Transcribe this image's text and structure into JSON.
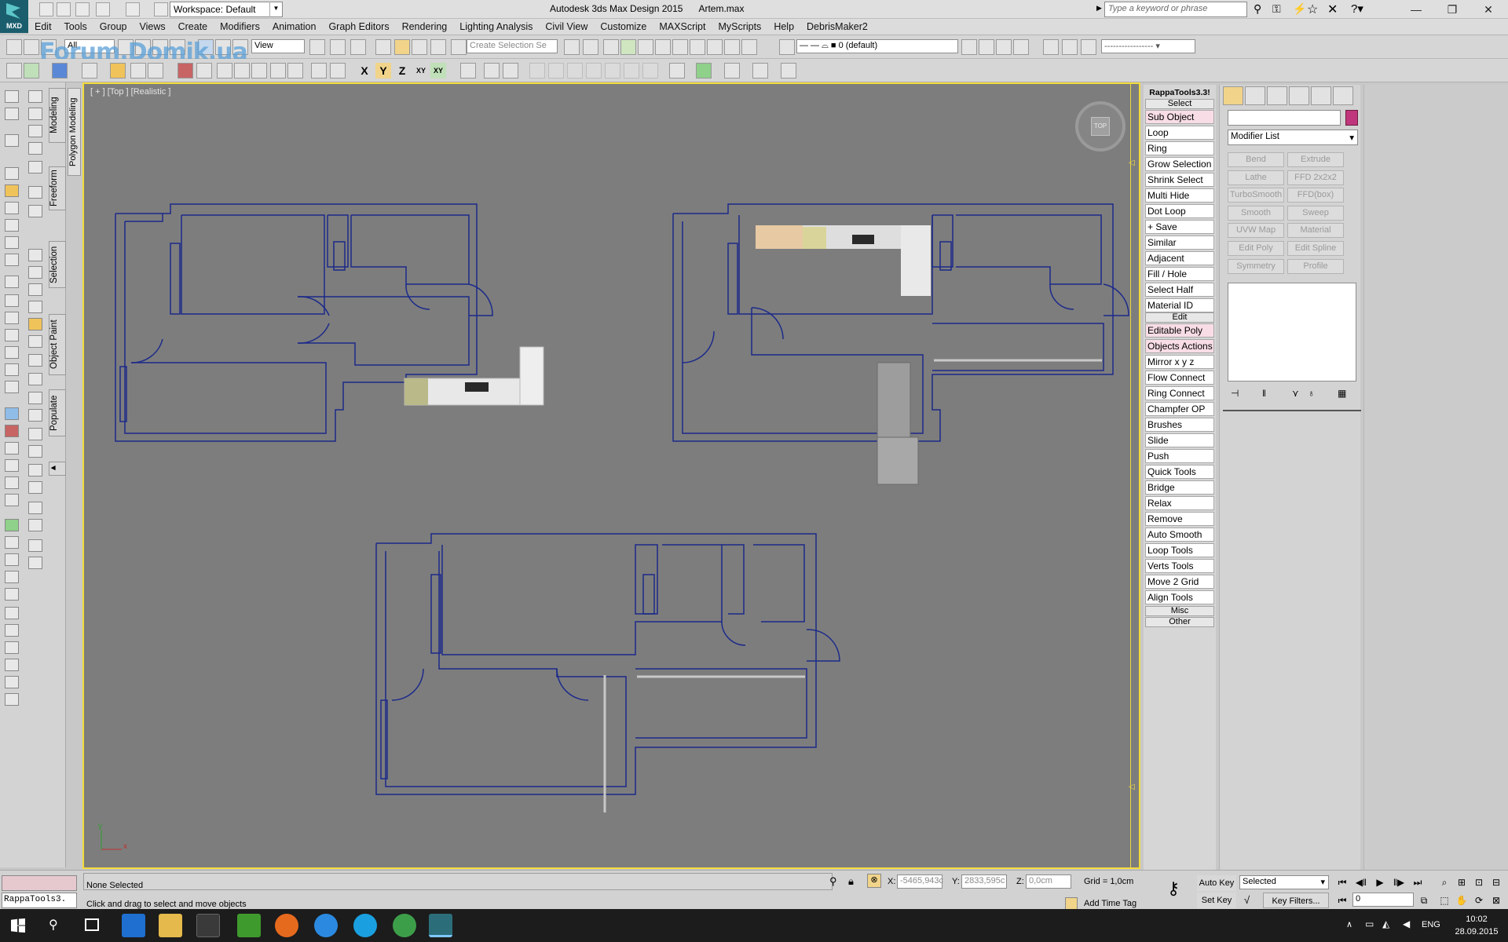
{
  "window": {
    "title": "Autodesk 3ds Max Design 2015",
    "file": "Artem.max",
    "logo_text": "MXD",
    "workspace": "Workspace: Default",
    "search_placeholder": "Type a keyword or phrase"
  },
  "menu": [
    "Edit",
    "Tools",
    "Group",
    "Views",
    "Create",
    "Modifiers",
    "Animation",
    "Graph Editors",
    "Rendering",
    "Lighting Analysis",
    "Civil View",
    "Customize",
    "MAXScript",
    "MyScripts",
    "Help",
    "DebrisMaker2"
  ],
  "toolbar": {
    "selection_filter": "All",
    "ref_coord": "View",
    "named_selection": "Create Selection Se",
    "layer": "0 (default)",
    "axis_x": "X",
    "axis_y": "Y",
    "axis_z": "Z",
    "axis_xy": "XY",
    "axis_xyz": "XY"
  },
  "watermark": "Forum.Domik.ua",
  "ribbon_tabs": [
    "Modeling",
    "Freeform",
    "Selection",
    "Object Paint",
    "Populate"
  ],
  "ribbon_sub": "Polygon Modeling",
  "viewport": {
    "label": "[ + ] [Top ] [Realistic ]",
    "navcube_face": "TOP",
    "axis_x": "x",
    "axis_y": "y"
  },
  "rappa": {
    "title": "RappaTools3.3!",
    "sections": [
      {
        "label": "Select",
        "items": [
          {
            "label": "Sub Object",
            "pink": true
          },
          {
            "label": "Loop",
            "pink": false
          },
          {
            "label": "Ring",
            "pink": false
          },
          {
            "label": "Grow Selection",
            "pink": false
          },
          {
            "label": "Shrink Select",
            "pink": false
          },
          {
            "label": "Multi Hide",
            "pink": false
          },
          {
            "label": "Dot Loop",
            "pink": false
          },
          {
            "label": "+ Save",
            "pink": false
          },
          {
            "label": "Similar",
            "pink": false
          },
          {
            "label": "Adjacent",
            "pink": false
          },
          {
            "label": "Fill / Hole",
            "pink": false
          },
          {
            "label": "Select Half",
            "pink": false
          },
          {
            "label": "Material ID",
            "pink": false
          }
        ]
      },
      {
        "label": "Edit",
        "items": [
          {
            "label": "Editable Poly",
            "pink": true
          },
          {
            "label": "Objects Actions",
            "pink": true
          },
          {
            "label": "Mirror   x  y  z",
            "pink": false
          },
          {
            "label": "Flow Connect",
            "pink": false
          },
          {
            "label": "Ring Connect",
            "pink": false
          },
          {
            "label": "Champfer OP",
            "pink": false
          },
          {
            "label": "Brushes",
            "pink": false
          },
          {
            "label": "Slide",
            "pink": false
          },
          {
            "label": "Push",
            "pink": false
          },
          {
            "label": "Quick Tools",
            "pink": false
          },
          {
            "label": "Bridge",
            "pink": false
          },
          {
            "label": "Relax",
            "pink": false
          },
          {
            "label": "Remove",
            "pink": false
          },
          {
            "label": "Auto Smooth",
            "pink": false
          },
          {
            "label": "Loop Tools",
            "pink": false
          },
          {
            "label": "Verts Tools",
            "pink": false
          },
          {
            "label": "Move 2 Grid",
            "pink": false
          },
          {
            "label": "Align Tools",
            "pink": false
          }
        ]
      },
      {
        "label": "Misc",
        "items": []
      },
      {
        "label": "Other",
        "items": []
      }
    ]
  },
  "command_panel": {
    "modifier_list": "Modifier List",
    "modifiers": [
      "Bend",
      "Extrude",
      "Lathe",
      "FFD 2x2x2",
      "TurboSmooth",
      "FFD(box)",
      "Smooth",
      "Sweep",
      "UVW Map",
      "Material",
      "Edit Poly",
      "Edit Spline",
      "Symmetry",
      "Profile"
    ]
  },
  "status": {
    "maxscript": "RappaTools3.",
    "selection": "None Selected",
    "prompt": "Click and drag to select and move objects",
    "x_label": "X:",
    "x_value": "-5465,943c",
    "y_label": "Y:",
    "y_value": "2833,595c",
    "z_label": "Z:",
    "z_value": "0,0cm",
    "grid": "Grid = 1,0cm",
    "add_time_tag": "Add Time Tag",
    "auto_key": "Auto Key",
    "set_key": "Set Key",
    "selected": "Selected",
    "key_filters": "Key Filters...",
    "frame": "0"
  },
  "taskbar": {
    "lang": "ENG",
    "time": "10:02",
    "date": "28.09.2015"
  },
  "colors": {
    "viewport_bg": "#7d7d7d",
    "active_border": "#f4dc3c",
    "plan_lines": "#1c2a8a",
    "taskbar": "#1c1c1c"
  }
}
